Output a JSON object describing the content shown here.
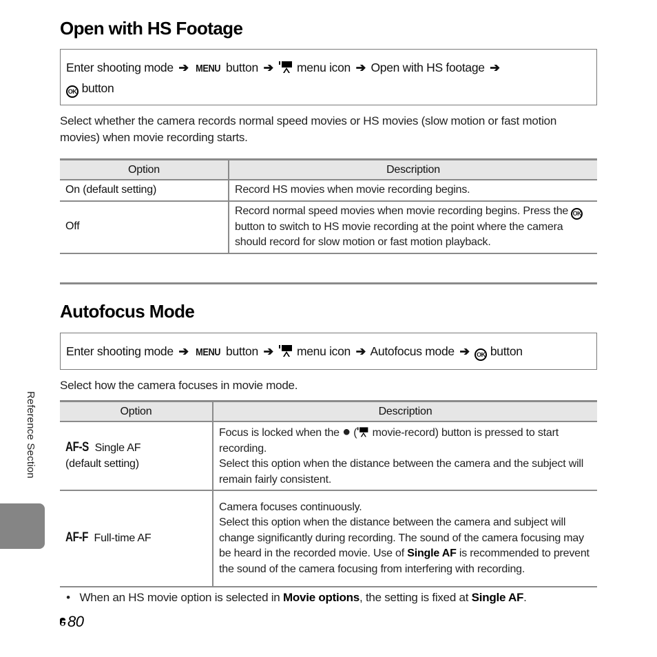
{
  "sections": [
    {
      "title": "Open with HS Footage",
      "procedure": {
        "step1": "Enter shooting mode",
        "menu_label": "MENU",
        "step2": "button",
        "step3": "menu icon",
        "step4": "Open with HS footage",
        "step5": "button"
      },
      "description": "Select whether the camera records normal speed movies or HS movies (slow motion or fast motion movies) when movie recording starts.",
      "table": {
        "headers": [
          "Option",
          "Description"
        ],
        "rows": [
          {
            "option": "On (default setting)",
            "description": "Record HS movies when movie recording begins."
          },
          {
            "option": "Off",
            "desc_a": "Record normal speed movies when movie recording begins. Press the",
            "desc_b": "button to switch to HS movie recording at the point where the camera should record for slow motion or fast motion playback."
          }
        ]
      }
    },
    {
      "title": "Autofocus Mode",
      "procedure": {
        "step1": "Enter shooting mode",
        "menu_label": "MENU",
        "step2": "button",
        "step3": "menu icon",
        "step4": "Autofocus mode",
        "step5": "button"
      },
      "description": "Select how the camera focuses in movie mode.",
      "table": {
        "headers": [
          "Option",
          "Description"
        ],
        "rows": [
          {
            "glyph": "AF-S",
            "option": "Single AF",
            "option_sub": "(default setting)",
            "desc_a": "Focus is locked when the",
            "desc_b": "movie-record) button is pressed to start recording.",
            "desc_c": "Select this option when the distance between the camera and the subject will remain fairly consistent."
          },
          {
            "glyph": "AF-F",
            "option": "Full-time AF",
            "desc_a": "Camera focuses continuously.",
            "desc_b": "Select this option when the distance between the camera and subject will change significantly during recording. The sound of the camera focusing may be heard in the recorded movie. Use of",
            "desc_bold": "Single AF",
            "desc_c": "is recommended to prevent the sound of the camera focusing from interfering with recording."
          }
        ]
      }
    }
  ],
  "note": {
    "bullet": "•",
    "text_a": "When an HS movie option is selected in",
    "bold_a": "Movie options",
    "text_b": ", the setting is fixed at",
    "bold_b": "Single AF",
    "text_c": "."
  },
  "side_label": "Reference Section",
  "page_number": "80",
  "icons": {
    "arrow": "➔",
    "ok": "OK",
    "record_dot": "●"
  }
}
